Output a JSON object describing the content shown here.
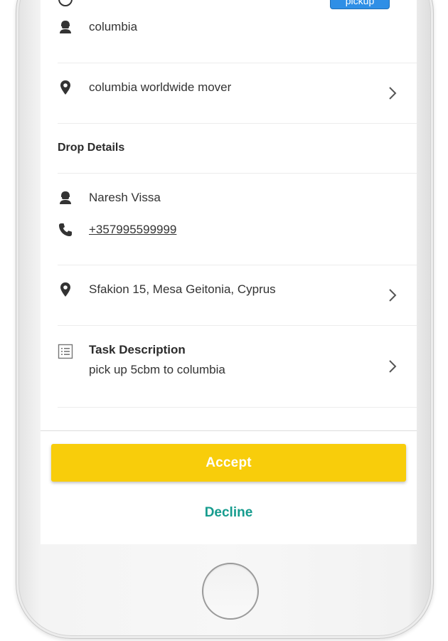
{
  "pickup": {
    "badge_label": "pickup",
    "name": "columbia",
    "address": "columbia worldwide mover"
  },
  "drop": {
    "section_title": "Drop Details",
    "name": "Naresh Vissa",
    "phone": "+357995599999",
    "address": "Sfakion 15, Mesa Geitonia, Cyprus"
  },
  "task": {
    "title": "Task Description",
    "description": "pick up 5cbm to columbia"
  },
  "actions": {
    "accept_label": "Accept",
    "decline_label": "Decline"
  },
  "icons": {
    "person": "person-icon",
    "location": "location-pin-icon",
    "phone": "phone-icon",
    "list": "list-icon",
    "chevron": "chevron-right-icon",
    "home": "home-button"
  },
  "colors": {
    "accept": "#f8cd0b",
    "decline": "#169c8e",
    "badge": "#2f8fe6"
  }
}
